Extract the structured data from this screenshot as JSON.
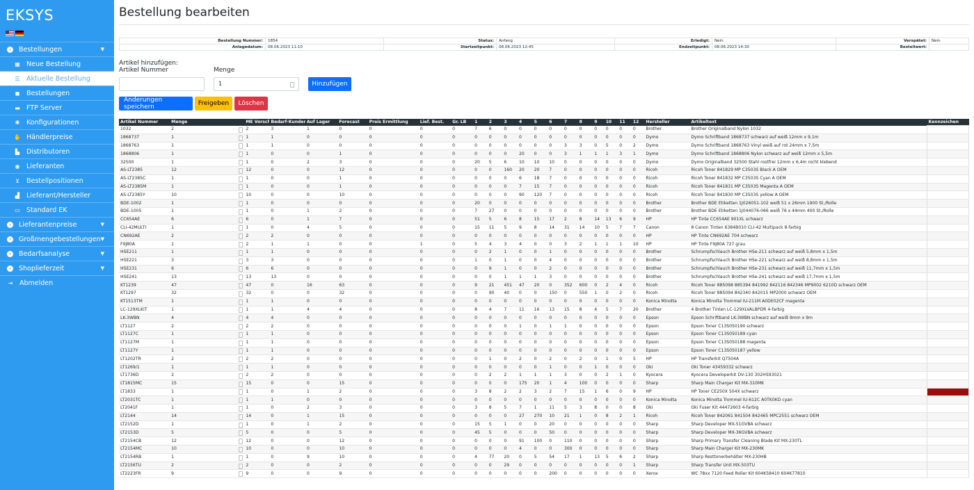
{
  "app": {
    "title": "EKSYS"
  },
  "nav": [
    {
      "label": "Bestellungen",
      "icon": "circle-icon",
      "level": "top",
      "caret": true
    },
    {
      "label": "Neue Bestellung",
      "icon": "calendar-icon",
      "level": "sub"
    },
    {
      "label": "Aktuelle Bestellung",
      "icon": "list-icon",
      "level": "sub",
      "active": true
    },
    {
      "label": "Bestellungen",
      "icon": "bag-icon",
      "level": "sub"
    },
    {
      "label": "FTP Server",
      "icon": "server-icon",
      "level": "sub"
    },
    {
      "label": "Konfigurationen",
      "icon": "gear-icon",
      "level": "sub"
    },
    {
      "label": "Händlerpreise",
      "icon": "hand-icon",
      "level": "sub"
    },
    {
      "label": "Distributoren",
      "icon": "sitemap-icon",
      "level": "sub"
    },
    {
      "label": "Lieferanten",
      "icon": "users-icon",
      "level": "sub"
    },
    {
      "label": "Bestellpositionen",
      "icon": "cart-icon",
      "level": "sub"
    },
    {
      "label": "Lieferant/Hersteller",
      "icon": "industry-icon",
      "level": "sub"
    },
    {
      "label": "Standard EK",
      "icon": "money-icon",
      "level": "sub"
    },
    {
      "label": "Lieferantenpreise",
      "icon": "circle-icon",
      "level": "top",
      "caret": true
    },
    {
      "label": "Großmengebestellungen",
      "icon": "circle-icon",
      "level": "top",
      "caret": true
    },
    {
      "label": "Bedarfsanalyse",
      "icon": "circle-icon",
      "level": "top",
      "caret": true
    },
    {
      "label": "Shoplieferzeit",
      "icon": "circle-icon",
      "level": "top",
      "caret": true
    },
    {
      "label": "Abmelden",
      "icon": "logout-icon",
      "level": "top"
    }
  ],
  "page": {
    "title": "Bestellung bearbeiten"
  },
  "order": {
    "row1": [
      {
        "label": "Bestellung Nummer:",
        "value": "1854"
      },
      {
        "label": "Status:",
        "value": "Anfang"
      },
      {
        "label": "Erledigt:",
        "value": "Nein"
      },
      {
        "label": "Verspätet:",
        "value": "Nein"
      }
    ],
    "row2": [
      {
        "label": "Anlagedatum:",
        "value": "08.06.2023 11:10"
      },
      {
        "label": "Startzeitpunkt:",
        "value": "08.06.2023 12:45"
      },
      {
        "label": "Endzeitpunkt:",
        "value": "08.06.2023 14:30"
      },
      {
        "label": "Bestellwert:",
        "value": ""
      }
    ]
  },
  "add": {
    "title": "Artikel hinzufügen:",
    "article_label": "Artikel Nummer",
    "article_value": "",
    "qty_label": "Menge",
    "qty_value": "1",
    "add_button": "Hinzufügen"
  },
  "actions": {
    "save": "Änderungen speichern",
    "release": "Freigeben",
    "delete": "Löschen"
  },
  "table": {
    "headers": [
      "Artikel Nummer",
      "Menge",
      "",
      "ME Vorsch",
      "Bedarf-Kunden",
      "Auf Lager",
      "Forecast",
      "Preis Ermittlung",
      "Lief. Best.",
      "Gr. LB",
      "1",
      "2",
      "3",
      "4",
      "5",
      "6",
      "7",
      "8",
      "9",
      "10",
      "11",
      "12",
      "Hersteller",
      "Artikeltext",
      "Kennzeichen"
    ],
    "rows": [
      [
        "1032",
        "2",
        "2",
        "3",
        "1",
        "0",
        "0",
        "0",
        "0",
        "7",
        "6",
        "0",
        "0",
        "0",
        "0",
        "0",
        "0",
        "0",
        "0",
        "0",
        "0",
        "Brother",
        "Brother Originalband Nylon 1032",
        ""
      ],
      [
        "1868737",
        "1",
        "1",
        "1",
        "0",
        "0",
        "0",
        "0",
        "0",
        "0",
        "0",
        "0",
        "0",
        "0",
        "0",
        "0",
        "0",
        "0",
        "0",
        "0",
        "0",
        "Dymo",
        "Dymo Schriftband 1868737 schwarz auf weiß 12mm x 9,1m",
        ""
      ],
      [
        "1868763",
        "1",
        "1",
        "1",
        "0",
        "0",
        "0",
        "0",
        "0",
        "0",
        "0",
        "0",
        "0",
        "0",
        "0",
        "3",
        "3",
        "0",
        "5",
        "0",
        "2",
        "Dymo",
        "Dymo Schriftband 1868763 Vinyl weiß auf rot 24mm x 7,5m",
        ""
      ],
      [
        "1868806",
        "1",
        "1",
        "0",
        "0",
        "1",
        "0",
        "0",
        "0",
        "0",
        "0",
        "0",
        "20",
        "0",
        "0",
        "3",
        "1",
        "1",
        "1",
        "3",
        "1",
        "Dymo",
        "Dymo Schriftband 1868806 Nylon schwarz auf weiß 12mm x 5,5m",
        ""
      ],
      [
        "32500",
        "1",
        "1",
        "0",
        "2",
        "3",
        "0",
        "0",
        "0",
        "20",
        "5",
        "6",
        "10",
        "10",
        "10",
        "0",
        "0",
        "0",
        "0",
        "0",
        "0",
        "Dymo",
        "Dymo Originalband 32500 Stahl rostfrei 12mm x 6,4m nicht klebend",
        ""
      ],
      [
        "AS-LT2385",
        "12",
        "12",
        "0",
        "0",
        "12",
        "0",
        "0",
        "0",
        "0",
        "0",
        "160",
        "20",
        "20",
        "7",
        "0",
        "0",
        "0",
        "0",
        "0",
        "0",
        "Ricoh",
        "Ricoh Toner 841829 MP C3503S Black A OEM",
        ""
      ],
      [
        "AS-LT2385C",
        "1",
        "1",
        "0",
        "0",
        "1",
        "0",
        "0",
        "0",
        "0",
        "0",
        "0",
        "6",
        "18",
        "7",
        "0",
        "0",
        "0",
        "0",
        "0",
        "0",
        "Ricoh",
        "Ricoh Toner 841832 MP C3503S Cyan A OEM",
        ""
      ],
      [
        "AS-LT2385M",
        "1",
        "1",
        "0",
        "0",
        "1",
        "0",
        "0",
        "0",
        "0",
        "0",
        "0",
        "7",
        "15",
        "7",
        "0",
        "0",
        "0",
        "0",
        "0",
        "0",
        "Ricoh",
        "Ricoh Toner 841831 MP C3503S Magenta A OEM",
        ""
      ],
      [
        "AS-LT2385Y",
        "10",
        "10",
        "0",
        "0",
        "10",
        "0",
        "0",
        "0",
        "0",
        "0",
        "0",
        "90",
        "120",
        "7",
        "0",
        "0",
        "0",
        "0",
        "0",
        "0",
        "Ricoh",
        "Ricoh Toner 841830 MP C3503S yellow A OEM",
        ""
      ],
      [
        "BDE-1002",
        "1",
        "1",
        "0",
        "0",
        "0",
        "0",
        "0",
        "0",
        "20",
        "0",
        "0",
        "0",
        "0",
        "0",
        "0",
        "0",
        "0",
        "0",
        "0",
        "0",
        "Brother",
        "Brother BDE Etiketten 1J026051-102 weiß 51 x 26mm 1900 St./Rolle",
        ""
      ],
      [
        "BDE-1005",
        "1",
        "1",
        "0",
        "1",
        "2",
        "0",
        "0",
        "0",
        "7",
        "27",
        "0",
        "0",
        "0",
        "0",
        "0",
        "0",
        "0",
        "0",
        "0",
        "0",
        "Brother",
        "Brother BDE Etiketten 1J044076-066 weiß 76 x 44mm 400 St./Rolle",
        ""
      ],
      [
        "CC654AE",
        "6",
        "6",
        "0",
        "1",
        "7",
        "0",
        "0",
        "0",
        "51",
        "5",
        "6",
        "8",
        "15",
        "17",
        "2",
        "8",
        "14",
        "13",
        "6",
        "9",
        "HP",
        "HP Tinte CC654AE 901XL schwarz",
        ""
      ],
      [
        "CLI-42MULTI",
        "1",
        "1",
        "0",
        "4",
        "5",
        "0",
        "0",
        "0",
        "15",
        "11",
        "5",
        "9",
        "8",
        "14",
        "31",
        "14",
        "10",
        "5",
        "7",
        "7",
        "Canon",
        "8 Canon Tinten 6384B010 CLI-42 Multipack 8-farbig",
        ""
      ],
      [
        "CN692AE",
        "2",
        "2",
        "2",
        "0",
        "0",
        "0",
        "0",
        "0",
        "0",
        "0",
        "0",
        "0",
        "0",
        "0",
        "0",
        "0",
        "0",
        "0",
        "0",
        "0",
        "HP",
        "HP Tinte CN692AE 704 schwarz",
        ""
      ],
      [
        "F9J80A",
        "1",
        "2",
        "1",
        "1",
        "0",
        "0",
        "1",
        "0",
        "5",
        "4",
        "3",
        "4",
        "0",
        "0",
        "3",
        "2",
        "1",
        "1",
        "1",
        "10",
        "HP",
        "HP Tinte F9J80A 727 grau",
        ""
      ],
      [
        "HSE211",
        "1",
        "1",
        "1",
        "0",
        "0",
        "0",
        "0",
        "0",
        "0",
        "2",
        "1",
        "0",
        "0",
        "1",
        "0",
        "0",
        "0",
        "0",
        "0",
        "0",
        "Brother",
        "Schrumpfschlauch Brother HSe-211 schwarz auf weiß 5,8mm x 1,5m",
        ""
      ],
      [
        "HSE221",
        "3",
        "3",
        "3",
        "0",
        "0",
        "0",
        "0",
        "0",
        "1",
        "0",
        "1",
        "0",
        "0",
        "4",
        "0",
        "0",
        "0",
        "0",
        "0",
        "0",
        "Brother",
        "Schrumpfschlauch Brother HSe-221 schwarz auf weiß 8,8mm x 1,5m",
        ""
      ],
      [
        "HSE231",
        "6",
        "6",
        "6",
        "0",
        "0",
        "0",
        "0",
        "0",
        "0",
        "9",
        "1",
        "0",
        "0",
        "2",
        "0",
        "0",
        "0",
        "0",
        "0",
        "0",
        "Brother",
        "Schrumpfschlauch Brother HSe-231 schwarz auf weiß 11,7mm x 1,5m",
        ""
      ],
      [
        "HSE241",
        "13",
        "13",
        "13",
        "0",
        "0",
        "0",
        "0",
        "0",
        "0",
        "0",
        "1",
        "1",
        "1",
        "3",
        "0",
        "0",
        "0",
        "0",
        "0",
        "0",
        "Brother",
        "Schrumpfschlauch Brother HSe-241 schwarz auf weiß 17,7mm x 1,5m",
        ""
      ],
      [
        "KT1239",
        "47",
        "47",
        "0",
        "16",
        "63",
        "0",
        "0",
        "0",
        "9",
        "21",
        "451",
        "47",
        "20",
        "0",
        "352",
        "600",
        "0",
        "2",
        "4",
        "0",
        "Ricoh",
        "Ricoh Toner 885098 885394 841992 842116 842346 MP9002 6210D schwarz OEM",
        ""
      ],
      [
        "KT1297",
        "32",
        "32",
        "0",
        "0",
        "32",
        "0",
        "0",
        "0",
        "0",
        "90",
        "40",
        "0",
        "0",
        "150",
        "0",
        "550",
        "1",
        "0",
        "2",
        "0",
        "Ricoh",
        "Ricoh Toner 885094 842340 842015 MP2000 schwarz OEM",
        ""
      ],
      [
        "KT1513TM",
        "1",
        "1",
        "1",
        "0",
        "0",
        "0",
        "0",
        "0",
        "0",
        "0",
        "0",
        "0",
        "0",
        "0",
        "0",
        "0",
        "0",
        "0",
        "0",
        "0",
        "Konica Minolta",
        "Konica Minolta Trommel IU-211M A0DE02CF magenta",
        ""
      ],
      [
        "LC-129XLKIT",
        "1",
        "1",
        "1",
        "4",
        "4",
        "0",
        "0",
        "0",
        "8",
        "4",
        "7",
        "11",
        "16",
        "13",
        "15",
        "8",
        "4",
        "5",
        "7",
        "20",
        "Brother",
        "4 Brother Tinten LC-129XLVALBPDR 4-farbig",
        ""
      ],
      [
        "LK-3WBN",
        "4",
        "4",
        "4",
        "0",
        "0",
        "0",
        "0",
        "0",
        "0",
        "0",
        "0",
        "0",
        "0",
        "0",
        "0",
        "0",
        "0",
        "0",
        "0",
        "0",
        "Epson",
        "Epson Schriftband LK-3WBN schwarz auf weiß 9mm x 9m",
        ""
      ],
      [
        "LT1127",
        "2",
        "2",
        "2",
        "0",
        "0",
        "0",
        "0",
        "0",
        "0",
        "0",
        "0",
        "1",
        "0",
        "1",
        "1",
        "0",
        "0",
        "0",
        "0",
        "0",
        "Epson",
        "Epson Toner C13S050190 schwarz",
        ""
      ],
      [
        "LT1127C",
        "1",
        "1",
        "1",
        "0",
        "0",
        "0",
        "0",
        "0",
        "0",
        "0",
        "0",
        "0",
        "0",
        "0",
        "0",
        "0",
        "0",
        "0",
        "0",
        "0",
        "Epson",
        "Epson Toner C13S050189 cyan",
        ""
      ],
      [
        "LT1127M",
        "1",
        "1",
        "1",
        "0",
        "0",
        "0",
        "0",
        "0",
        "0",
        "0",
        "0",
        "0",
        "0",
        "0",
        "0",
        "0",
        "0",
        "0",
        "0",
        "0",
        "Epson",
        "Epson Toner C13S050188 magenta",
        ""
      ],
      [
        "LT1127Y",
        "1",
        "1",
        "1",
        "0",
        "0",
        "0",
        "0",
        "0",
        "0",
        "0",
        "0",
        "0",
        "0",
        "0",
        "0",
        "0",
        "0",
        "0",
        "0",
        "0",
        "Epson",
        "Epson Toner C13S050187 yellow",
        ""
      ],
      [
        "LT1202TR",
        "2",
        "2",
        "2",
        "0",
        "0",
        "0",
        "0",
        "0",
        "0",
        "1",
        "0",
        "2",
        "0",
        "2",
        "0",
        "2",
        "0",
        "1",
        "0",
        "5",
        "HP",
        "HP Transferkit Q7504A",
        ""
      ],
      [
        "LT1269/1",
        "1",
        "1",
        "1",
        "0",
        "0",
        "0",
        "0",
        "0",
        "0",
        "0",
        "0",
        "0",
        "0",
        "1",
        "0",
        "0",
        "1",
        "0",
        "0",
        "0",
        "Oki",
        "Oki Toner 43459332 schwarz",
        ""
      ],
      [
        "LT1736D",
        "2",
        "2",
        "2",
        "0",
        "0",
        "0",
        "0",
        "0",
        "0",
        "2",
        "2",
        "1",
        "1",
        "1",
        "3",
        "0",
        "0",
        "2",
        "1",
        "0",
        "Kyocera",
        "Kyocera Developerkit DV-130 302HS93021",
        ""
      ],
      [
        "LT1815MC",
        "15",
        "15",
        "0",
        "0",
        "15",
        "0",
        "0",
        "0",
        "0",
        "0",
        "0",
        "175",
        "20",
        "1",
        "4",
        "100",
        "0",
        "0",
        "0",
        "0",
        "Sharp",
        "Sharp Main Charger Kit MX-310MK",
        ""
      ],
      [
        "LT1833",
        "1",
        "1",
        "0",
        "1",
        "2",
        "0",
        "0",
        "0",
        "3",
        "8",
        "2",
        "2",
        "3",
        "2",
        "7",
        "15",
        "1",
        "6",
        "0",
        "9",
        "HP",
        "HP Toner CE250X 504X schwarz",
        "red"
      ],
      [
        "LT2031TC",
        "1",
        "1",
        "1",
        "0",
        "0",
        "0",
        "0",
        "0",
        "0",
        "0",
        "0",
        "0",
        "0",
        "0",
        "0",
        "0",
        "0",
        "0",
        "0",
        "0",
        "Konica Minolta",
        "Konica Minolta Trommel IU-612C A0TK0KD cyan",
        ""
      ],
      [
        "LT2041F",
        "1",
        "1",
        "0",
        "2",
        "3",
        "0",
        "0",
        "0",
        "3",
        "8",
        "5",
        "7",
        "1",
        "11",
        "5",
        "3",
        "8",
        "0",
        "0",
        "8",
        "Oki",
        "Oki Fuser Kit 44472603 4-farbig",
        ""
      ],
      [
        "LT2144",
        "14",
        "14",
        "0",
        "1",
        "15",
        "0",
        "0",
        "0",
        "0",
        "0",
        "0",
        "27",
        "270",
        "10",
        "21",
        "1",
        "0",
        "8",
        "2",
        "1",
        "Ricoh",
        "Ricoh Toner 842061 841504 842465 MPC2551 schwarz OEM",
        ""
      ],
      [
        "LT2152D",
        "1",
        "1",
        "0",
        "1",
        "2",
        "0",
        "0",
        "0",
        "15",
        "5",
        "1",
        "0",
        "0",
        "20",
        "0",
        "0",
        "0",
        "0",
        "0",
        "0",
        "Sharp",
        "Sharp Developer MX-51GVBA schwarz",
        ""
      ],
      [
        "LT2153D",
        "5",
        "5",
        "0",
        "0",
        "5",
        "0",
        "0",
        "0",
        "45",
        "5",
        "0",
        "0",
        "0",
        "50",
        "0",
        "0",
        "0",
        "0",
        "0",
        "0",
        "Sharp",
        "Sharp Developer MX-36GVBA schwarz",
        ""
      ],
      [
        "LT2154CB",
        "12",
        "12",
        "0",
        "0",
        "12",
        "0",
        "0",
        "0",
        "0",
        "0",
        "0",
        "91",
        "100",
        "0",
        "110",
        "0",
        "0",
        "0",
        "0",
        "0",
        "Sharp",
        "Sharp Primary Transfer Cleaning Blade Kit MX-230TL",
        ""
      ],
      [
        "LT2154MC",
        "10",
        "10",
        "0",
        "0",
        "10",
        "0",
        "0",
        "0",
        "0",
        "0",
        "0",
        "4",
        "0",
        "0",
        "300",
        "0",
        "0",
        "0",
        "0",
        "0",
        "Sharp",
        "Sharp Main Charger Kit MX-230MK",
        ""
      ],
      [
        "LT2154RB",
        "1",
        "1",
        "0",
        "9",
        "10",
        "0",
        "0",
        "0",
        "4",
        "77",
        "20",
        "0",
        "5",
        "54",
        "17",
        "1",
        "13",
        "5",
        "6",
        "2",
        "Sharp",
        "Sharp Resttonerbehälter MX-230HB",
        ""
      ],
      [
        "LT2156TU",
        "2",
        "2",
        "0",
        "0",
        "2",
        "0",
        "0",
        "0",
        "0",
        "0",
        "29",
        "0",
        "0",
        "0",
        "0",
        "0",
        "0",
        "0",
        "0",
        "1",
        "Sharp",
        "Sharp Transfer Unit MX-503TU",
        ""
      ],
      [
        "LT2223FR",
        "9",
        "9",
        "0",
        "0",
        "9",
        "0",
        "0",
        "0",
        "0",
        "0",
        "0",
        "0",
        "0",
        "200",
        "0",
        "0",
        "0",
        "0",
        "0",
        "0",
        "Xerox",
        "WC 78xx 7120 Feed Roller Kit 604K58410 604K77810",
        ""
      ]
    ]
  },
  "colors": {
    "sidebar": "#2f9bf0",
    "header": "#263238",
    "primary": "#0d6efd",
    "warn": "#ffc107",
    "danger": "#dc3545",
    "flag": "#9b0d0d"
  }
}
